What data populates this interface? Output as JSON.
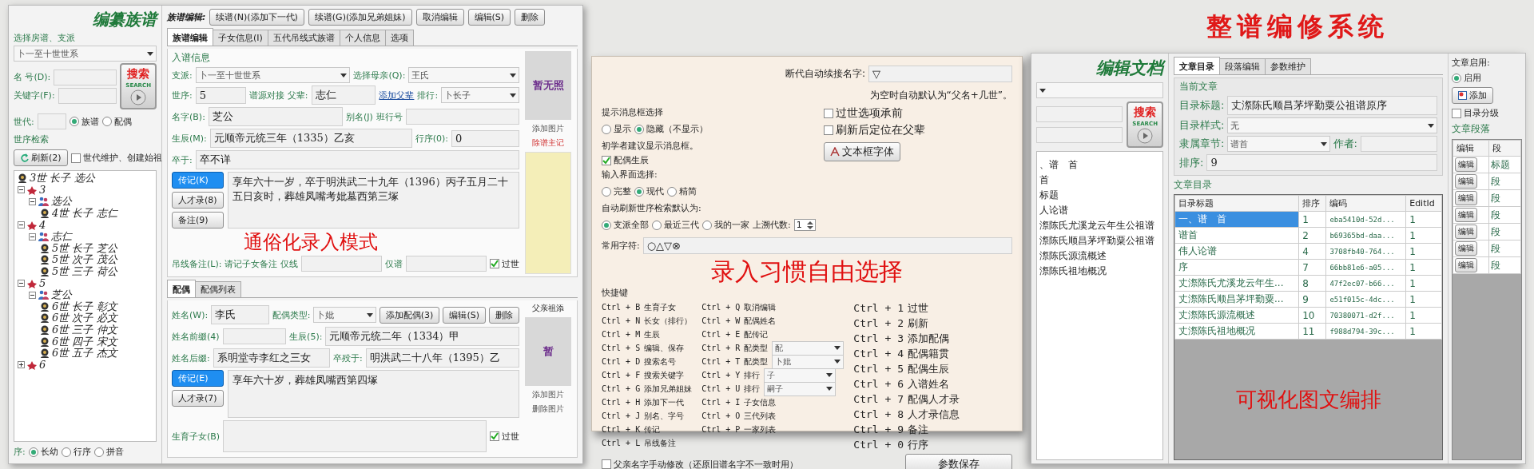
{
  "title": "整谱编修系统",
  "editor": {
    "heading": "编纂族谱",
    "sidebar": {
      "branch_label": "选择房谱、支派",
      "branch_value": "卜一至十世世系",
      "name_label": "名 号(D):",
      "keyword_label": "关键字(F):",
      "search_button": "搜索",
      "search_caption": "SEARCH",
      "generation_label": "世代:",
      "scope": [
        {
          "label": "族谱",
          "selected": true
        },
        {
          "label": "配偶",
          "selected": false
        }
      ],
      "order_label": "世序检索",
      "refresh_button": "刷新(2)",
      "maintain": {
        "label": "世代维护、创建始祖",
        "checked": false
      },
      "tree": [
        {
          "kind": "person",
          "label": "3世 长子 选公"
        },
        {
          "kind": "generation",
          "label": "3",
          "expanded": true,
          "children": [
            {
              "kind": "couple",
              "label": "选公",
              "expanded": true,
              "children": [
                {
                  "kind": "person",
                  "label": "4世 长子 志仁"
                }
              ]
            }
          ]
        },
        {
          "kind": "generation",
          "label": "4",
          "expanded": true,
          "children": [
            {
              "kind": "couple",
              "label": "志仁",
              "expanded": true,
              "children": [
                {
                  "kind": "person",
                  "label": "5世 长子 芝公"
                },
                {
                  "kind": "person",
                  "label": "5世 次子 茂公"
                },
                {
                  "kind": "person",
                  "label": "5世 三子 荷公"
                }
              ]
            }
          ]
        },
        {
          "kind": "generation",
          "label": "5",
          "expanded": true,
          "children": [
            {
              "kind": "couple",
              "label": "芝公",
              "expanded": true,
              "children": [
                {
                  "kind": "person",
                  "label": "6世 长子 彰文"
                },
                {
                  "kind": "person",
                  "label": "6世 次子 必文"
                },
                {
                  "kind": "person",
                  "label": "6世 三子 仲文"
                },
                {
                  "kind": "person",
                  "label": "6世 四子 宋文"
                },
                {
                  "kind": "person",
                  "label": "6世 五子 杰文"
                }
              ]
            }
          ]
        },
        {
          "kind": "generation",
          "label": "6",
          "expanded": false
        }
      ],
      "sort_label": "序:",
      "sort": [
        {
          "label": "长幼",
          "selected": true
        },
        {
          "label": "行序",
          "selected": false
        },
        {
          "label": "拼音",
          "selected": false
        }
      ]
    },
    "toolbar_label": "族谱编辑:",
    "toolbar": [
      "续谱(N)(添加下一代)",
      "续谱(G)(添加兄弟姐妹)",
      "取消编辑",
      "编辑(S)",
      "删除"
    ],
    "tabs": [
      {
        "label": "族谱编辑",
        "selected": true
      },
      {
        "label": "子女信息(I)",
        "selected": false
      },
      {
        "label": "五代吊线式族谱",
        "selected": false
      },
      {
        "label": "个人信息",
        "selected": false
      },
      {
        "label": "选项",
        "selected": false
      }
    ],
    "group_title": "入谱信息",
    "rows": [
      {
        "kind": "fields",
        "items": [
          {
            "kind": "label",
            "text": "支派:"
          },
          {
            "kind": "select",
            "value": "卜一至十世世系"
          },
          {
            "kind": "label",
            "text": "选择母亲(Q):"
          },
          {
            "kind": "select",
            "value": "王氏"
          }
        ]
      },
      {
        "kind": "fields",
        "items": [
          {
            "kind": "label",
            "text": "世序:"
          },
          {
            "kind": "input",
            "value": "5"
          },
          {
            "kind": "label",
            "text": "谱源对接"
          },
          {
            "kind": "label",
            "text": "父辈:"
          },
          {
            "kind": "input",
            "value": "志仁"
          },
          {
            "kind": "link",
            "text": "添加父辈"
          },
          {
            "kind": "label",
            "text": "排行:"
          },
          {
            "kind": "select",
            "value": "卜长子"
          }
        ]
      },
      {
        "kind": "fields",
        "items": [
          {
            "kind": "label",
            "text": "名字(B):"
          },
          {
            "kind": "input",
            "value": "芝公"
          },
          {
            "kind": "label",
            "text": "别名(J)"
          },
          {
            "kind": "label",
            "text": "班行号"
          },
          {
            "kind": "input"
          }
        ]
      },
      {
        "kind": "fields",
        "items": [
          {
            "kind": "label",
            "text": "生辰(M):"
          },
          {
            "kind": "input",
            "value": "元顺帝元统三年（1335）乙亥"
          },
          {
            "kind": "label",
            "text": "行序(0):"
          },
          {
            "kind": "input",
            "value": "0"
          }
        ]
      },
      {
        "kind": "fields",
        "items": [
          {
            "kind": "label",
            "text": "卒于:"
          },
          {
            "kind": "input",
            "value": "卒不详"
          }
        ]
      },
      {
        "kind": "notes",
        "buttons": [
          {
            "label": "传记(K)",
            "active": true
          },
          {
            "label": "人才录(8)",
            "active": false
          },
          {
            "label": "备注(9)",
            "active": false
          }
        ],
        "text": "享年六十一岁，卒于明洪武二十九年（1396）丙子五月二十五日亥时，葬雄凤嘴考妣墓西第三塚"
      },
      {
        "kind": "slogan",
        "text": "通俗化录入模式"
      },
      {
        "kind": "fields",
        "items": [
          {
            "kind": "label",
            "text": "吊线备注(L):"
          },
          {
            "kind": "label",
            "text": "请记子女备注"
          },
          {
            "kind": "label",
            "text": "仅线"
          },
          {
            "kind": "input"
          },
          {
            "kind": "label",
            "text": "仅谱"
          },
          {
            "kind": "input"
          },
          {
            "kind": "check",
            "text": "过世",
            "checked": true
          }
        ]
      }
    ],
    "photo": {
      "caption": "暂无照",
      "add": "添加图片",
      "note": "除谱主记"
    },
    "spouse_tabs": [
      {
        "label": "配偶",
        "selected": true
      },
      {
        "label": "配偶列表",
        "selected": false
      }
    ],
    "spouse_rows": [
      {
        "kind": "fields",
        "items": [
          {
            "kind": "label",
            "text": "姓名(W):"
          },
          {
            "kind": "input",
            "value": "李氏"
          },
          {
            "kind": "label",
            "text": "配偶类型:"
          },
          {
            "kind": "select",
            "value": "卜妣"
          },
          {
            "kind": "button",
            "text": "添加配偶(3)"
          },
          {
            "kind": "button",
            "text": "编辑(S)"
          },
          {
            "kind": "button",
            "text": "删除"
          }
        ]
      },
      {
        "kind": "fields",
        "items": [
          {
            "kind": "label",
            "text": "姓名前缀(4)"
          },
          {
            "kind": "input"
          },
          {
            "kind": "label",
            "text": "生辰(5):"
          },
          {
            "kind": "input",
            "value": "元顺帝元统二年（1334）甲"
          }
        ]
      },
      {
        "kind": "fields",
        "items": [
          {
            "kind": "label",
            "text": "姓名后缀:"
          },
          {
            "kind": "input",
            "value": "系明堂寺李红之三女"
          },
          {
            "kind": "label",
            "text": "卒殁于:"
          },
          {
            "kind": "input",
            "value": "明洪武二十八年（1395）乙"
          }
        ]
      },
      {
        "kind": "notes",
        "buttons": [
          {
            "label": "传记(E)",
            "active": true
          },
          {
            "label": "人才录(7)",
            "active": false
          }
        ],
        "text": "享年六十岁，葬雄凤嘴西第四塚"
      },
      {
        "kind": "fields",
        "items": [
          {
            "kind": "label",
            "text": "生育子女(B)"
          },
          {
            "kind": "area"
          },
          {
            "kind": "check",
            "text": "过世",
            "checked": true
          }
        ]
      }
    ],
    "spouse_photo": {
      "heading": "父亲祖添",
      "caption": "暂",
      "add": "添加图片",
      "remove": "删除图片"
    }
  },
  "options": {
    "name_fill": {
      "label": "断代自动续接名字:",
      "value": "▽",
      "note": "为空时自动默认为“父名+几世”。"
    },
    "message": {
      "label": "提示消息框选择",
      "choices": [
        {
          "label": "显示",
          "selected": false
        },
        {
          "label": "隐藏（不显示）",
          "selected": true
        }
      ],
      "note": "初学者建议显示消息框。"
    },
    "checks": [
      {
        "label": "配偶生辰",
        "checked": true
      },
      {
        "label": "过世选项承前",
        "checked": false
      },
      {
        "label": "刷新后定位在父辈",
        "checked": false
      }
    ],
    "layout": {
      "label": "输入界面选择:",
      "choices": [
        {
          "label": "完整",
          "selected": false
        },
        {
          "label": "现代",
          "selected": true
        },
        {
          "label": "精简",
          "selected": false
        }
      ]
    },
    "refresh": {
      "label": "自动刷新世序检索默认为:",
      "choices": [
        {
          "label": "支派全部",
          "selected": true
        },
        {
          "label": "最近三代",
          "selected": false
        },
        {
          "label": "我的一家",
          "selected": false
        }
      ],
      "depth_label": "上溯代数:",
      "depth_value": "1"
    },
    "font_button": "文本框字体",
    "chars": {
      "label": "常用字符:",
      "value": "○△▽⊗"
    },
    "slogan": "录入习惯自由选择",
    "shortcut_label": "快捷键",
    "shortcut_columns": [
      {
        "kind": "small",
        "items": [
          {
            "key": "Ctrl + B",
            "action": "生育子女"
          },
          {
            "key": "Ctrl + N",
            "action": "长女（排行）"
          },
          {
            "key": "Ctrl + M",
            "action": "生辰"
          },
          {
            "key": "Ctrl + S",
            "action": "编辑、保存"
          },
          {
            "key": "Ctrl + D",
            "action": "搜索名号"
          },
          {
            "key": "Ctrl + F",
            "action": "搜索关键字"
          },
          {
            "key": "Ctrl + G",
            "action": "添加兄弟姐妹"
          },
          {
            "key": "Ctrl + H",
            "action": "添加下一代"
          },
          {
            "key": "Ctrl + J",
            "action": "别名、字号"
          },
          {
            "key": "Ctrl + K",
            "action": "传记"
          },
          {
            "key": "Ctrl + L",
            "action": "吊线备注"
          }
        ]
      },
      {
        "kind": "small",
        "items": [
          {
            "key": "Ctrl + Q",
            "action": "取消编辑"
          },
          {
            "key": "Ctrl + W",
            "action": "配偶姓名"
          },
          {
            "key": "Ctrl + E",
            "action": "配传记"
          },
          {
            "key": "Ctrl + R",
            "action": "配类型",
            "value": "配"
          },
          {
            "key": "Ctrl + T",
            "action": "配类型",
            "value": "卜妣"
          },
          {
            "key": "Ctrl + Y",
            "action": "排行",
            "value": "子"
          },
          {
            "key": "Ctrl + U",
            "action": "排行",
            "value": "嗣子"
          },
          {
            "key": "Ctrl + I",
            "action": "子女信息"
          },
          {
            "key": "Ctrl + O",
            "action": "三代列表"
          },
          {
            "key": "Ctrl + P",
            "action": "一家列表"
          }
        ]
      },
      {
        "kind": "large",
        "items": [
          {
            "key": "Ctrl + 1",
            "action": "过世"
          },
          {
            "key": "Ctrl + 2",
            "action": "刷新"
          },
          {
            "key": "Ctrl + 3",
            "action": "添加配偶"
          },
          {
            "key": "Ctrl + 4",
            "action": "配偶籍贯"
          },
          {
            "key": "Ctrl + 5",
            "action": "配偶生辰"
          },
          {
            "key": "Ctrl + 6",
            "action": "入谱姓名"
          },
          {
            "key": "Ctrl + 7",
            "action": "配偶人才录"
          },
          {
            "key": "Ctrl + 8",
            "action": "人才录信息"
          },
          {
            "key": "Ctrl + 9",
            "action": "备注"
          },
          {
            "key": "Ctrl + 0",
            "action": "行序"
          }
        ]
      }
    ],
    "manual": {
      "label": "父亲名字手动修改（还原旧谱名字不一致时用）",
      "checked": false
    },
    "save_button": "参数保存"
  },
  "docs": {
    "heading": "编辑文档",
    "search_button": "搜索",
    "search_caption": "SEARCH",
    "outline": [
      "、谱　首",
      "首",
      "标题",
      "人论谱",
      "漈陈氏尤溪龙云年生公祖谱",
      "漈陈氏顺昌茅坪勤粟公祖谱",
      "漈陈氏源流概述",
      "漈陈氏祖地概况"
    ],
    "tabs": [
      {
        "label": "文章目录",
        "selected": true
      },
      {
        "label": "段落编辑",
        "selected": false
      },
      {
        "label": "参数维护",
        "selected": false
      }
    ],
    "group_title": "当前文章",
    "rows": [
      {
        "kind": "fields",
        "items": [
          {
            "kind": "label",
            "text": "目录标题:"
          },
          {
            "kind": "input",
            "value": "丈漈陈氏顺昌茅坪勤粟公祖谱原序"
          }
        ]
      },
      {
        "kind": "fields",
        "items": [
          {
            "kind": "label",
            "text": "目录样式:"
          },
          {
            "kind": "select",
            "value": "无"
          }
        ]
      },
      {
        "kind": "fields",
        "items": [
          {
            "kind": "label",
            "text": "隶属章节:"
          },
          {
            "kind": "select",
            "value": "谱首"
          },
          {
            "kind": "label",
            "text": "作者:"
          },
          {
            "kind": "input"
          }
        ]
      },
      {
        "kind": "fields",
        "items": [
          {
            "kind": "label",
            "text": "排序:"
          },
          {
            "kind": "input",
            "value": "9"
          }
        ]
      }
    ],
    "list_title": "文章目录",
    "table": {
      "columns": [
        "目录标题",
        "排序",
        "编码",
        "EditId"
      ],
      "rows": [
        {
          "selected": true,
          "cells": [
            "一、谱　首",
            "1",
            "eba5410d-52d...",
            "1"
          ]
        },
        {
          "selected": false,
          "cells": [
            "谱首",
            "2",
            "b69365bd-daa...",
            "1"
          ]
        },
        {
          "selected": false,
          "cells": [
            "伟人论谱",
            "4",
            "3708fb40-764...",
            "1"
          ]
        },
        {
          "selected": false,
          "cells": [
            "序",
            "7",
            "66bb81e6-a05...",
            "1"
          ]
        },
        {
          "selected": false,
          "cells": [
            "丈漈陈氏尤溪龙云年生...",
            "8",
            "47f2ec07-b66...",
            "1"
          ]
        },
        {
          "selected": false,
          "cells": [
            "丈漈陈氏顺昌茅坪勤粟...",
            "9",
            "e51f015c-4dc...",
            "1"
          ]
        },
        {
          "selected": false,
          "cells": [
            "丈漈陈氏源流概述",
            "10",
            "70380071-d2f...",
            "1"
          ]
        },
        {
          "selected": false,
          "cells": [
            "丈漈陈氏祖地概况",
            "11",
            "f988d794-39c...",
            "1"
          ]
        }
      ]
    },
    "slogan": "可视化图文编排",
    "enable_label": "文章启用:",
    "enable": [
      {
        "label": "启用",
        "selected": true
      }
    ],
    "add_button": "添加",
    "level_check": {
      "label": "目录分级",
      "checked": false
    },
    "section_label": "文章段落",
    "para_table": {
      "columns": [
        "编辑",
        "段"
      ],
      "rows": [
        {
          "button": "编辑",
          "text": "标题"
        },
        {
          "button": "编辑",
          "text": "段"
        },
        {
          "button": "编辑",
          "text": "段"
        },
        {
          "button": "编辑",
          "text": "段"
        },
        {
          "button": "编辑",
          "text": "段"
        },
        {
          "button": "编辑",
          "text": "段"
        },
        {
          "button": "编辑",
          "text": "段"
        }
      ]
    }
  }
}
